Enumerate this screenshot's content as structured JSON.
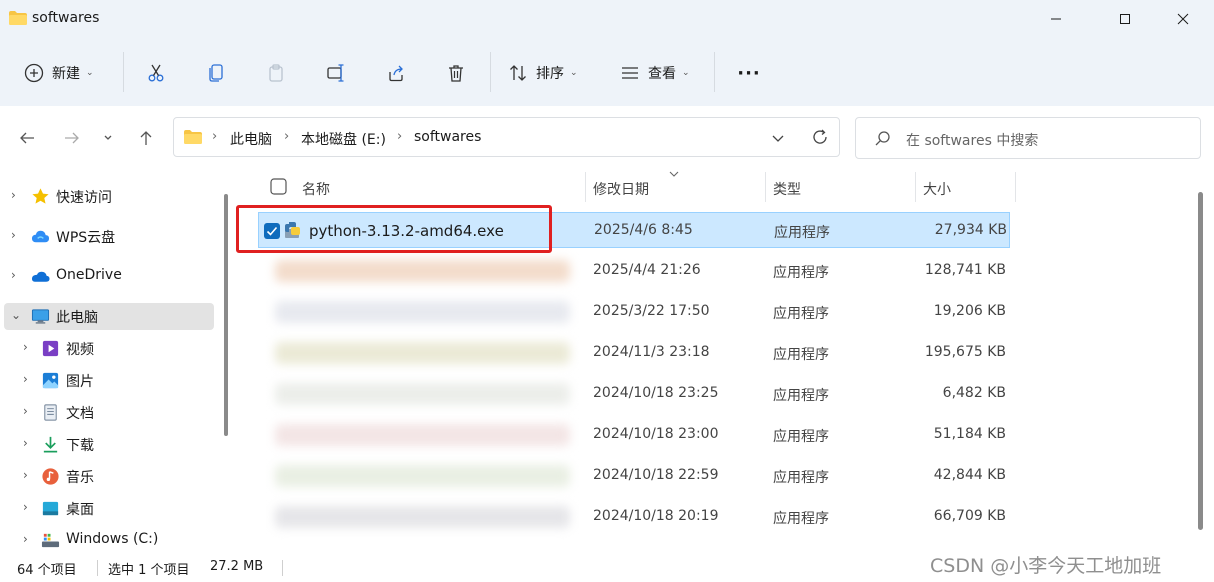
{
  "window": {
    "title": "softwares"
  },
  "toolbar": {
    "new_label": "新建",
    "sort_label": "排序",
    "view_label": "查看",
    "more_label": "···"
  },
  "address": {
    "crumbs": [
      "此电脑",
      "本地磁盘 (E:)",
      "softwares"
    ]
  },
  "search": {
    "placeholder": "在 softwares 中搜索"
  },
  "sidebar": {
    "items": [
      {
        "label": "快速访问",
        "icon": "star-icon"
      },
      {
        "label": "WPS云盘",
        "icon": "cloud-icon"
      },
      {
        "label": "OneDrive",
        "icon": "onedrive-icon"
      },
      {
        "label": "此电脑",
        "icon": "computer-icon"
      },
      {
        "label": "视频",
        "icon": "video-icon"
      },
      {
        "label": "图片",
        "icon": "picture-icon"
      },
      {
        "label": "文档",
        "icon": "document-icon"
      },
      {
        "label": "下载",
        "icon": "download-icon"
      },
      {
        "label": "音乐",
        "icon": "music-icon"
      },
      {
        "label": "桌面",
        "icon": "desktop-icon"
      },
      {
        "label": "Windows (C:)",
        "icon": "drive-icon"
      }
    ]
  },
  "columns": {
    "name": "名称",
    "modified": "修改日期",
    "type": "类型",
    "size": "大小"
  },
  "files": [
    {
      "name": "python-3.13.2-amd64.exe",
      "modified": "2025/4/6 8:45",
      "type": "应用程序",
      "size": "27,934 KB",
      "selected": true
    },
    {
      "name": "",
      "modified": "2025/4/4 21:26",
      "type": "应用程序",
      "size": "128,741 KB"
    },
    {
      "name": "",
      "modified": "2025/3/22 17:50",
      "type": "应用程序",
      "size": "19,206 KB"
    },
    {
      "name": "",
      "modified": "2024/11/3 23:18",
      "type": "应用程序",
      "size": "195,675 KB"
    },
    {
      "name": "",
      "modified": "2024/10/18 23:25",
      "type": "应用程序",
      "size": "6,482 KB"
    },
    {
      "name": "",
      "modified": "2024/10/18 23:00",
      "type": "应用程序",
      "size": "51,184 KB"
    },
    {
      "name": "",
      "modified": "2024/10/18 22:59",
      "type": "应用程序",
      "size": "42,844 KB"
    },
    {
      "name": "",
      "modified": "2024/10/18 20:19",
      "type": "应用程序",
      "size": "66,709 KB"
    }
  ],
  "status": {
    "count": "64 个项目",
    "selection": "选中 1 个项目",
    "selection_size": "27.2 MB"
  },
  "watermark": "CSDN @小李今天工地加班",
  "colors": {
    "selection_bg": "#cce8ff",
    "highlight_box": "#e02020",
    "chrome_bg": "#eef3f9"
  }
}
